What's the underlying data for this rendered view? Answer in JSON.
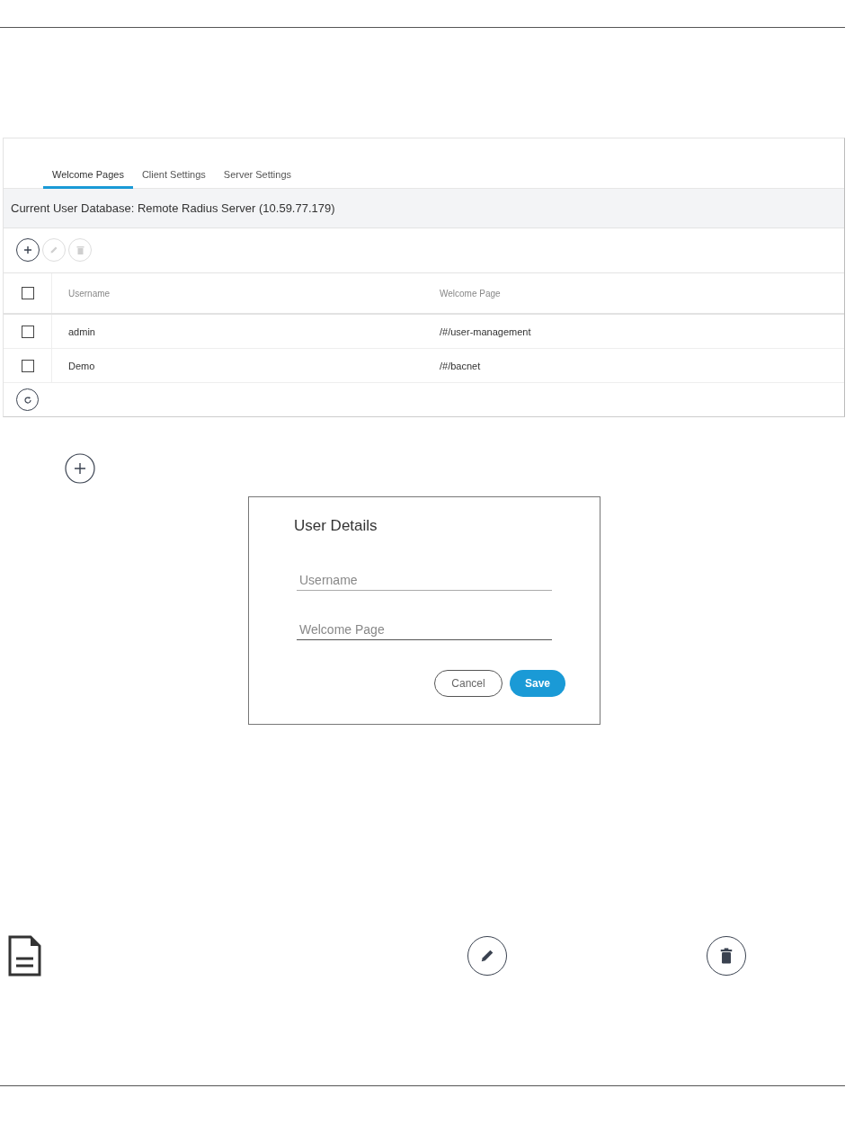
{
  "tabs": [
    {
      "label": "Welcome Pages",
      "selected": true
    },
    {
      "label": "Client Settings",
      "selected": false
    },
    {
      "label": "Server Settings",
      "selected": false
    }
  ],
  "database_banner": "Current User Database: Remote Radius Server (10.59.77.179)",
  "toolbar": [
    {
      "kind": "add",
      "disabled": false
    },
    {
      "kind": "edit",
      "disabled": true
    },
    {
      "kind": "delete",
      "disabled": true
    }
  ],
  "table": {
    "columns": [
      "Username",
      "Welcome Page"
    ],
    "header_checked": false,
    "rows": [
      {
        "cells": [
          "admin",
          "/#/user-management"
        ],
        "checked": false
      },
      {
        "cells": [
          "Demo",
          "/#/bacnet"
        ],
        "checked": false
      }
    ]
  },
  "dialog": {
    "title": "User Details",
    "fields": [
      {
        "placeholder": "Username"
      },
      {
        "placeholder": "Welcome Page"
      }
    ],
    "buttons": [
      {
        "label": "Cancel",
        "kind": "secondary"
      },
      {
        "label": "Save",
        "kind": "primary"
      }
    ]
  }
}
